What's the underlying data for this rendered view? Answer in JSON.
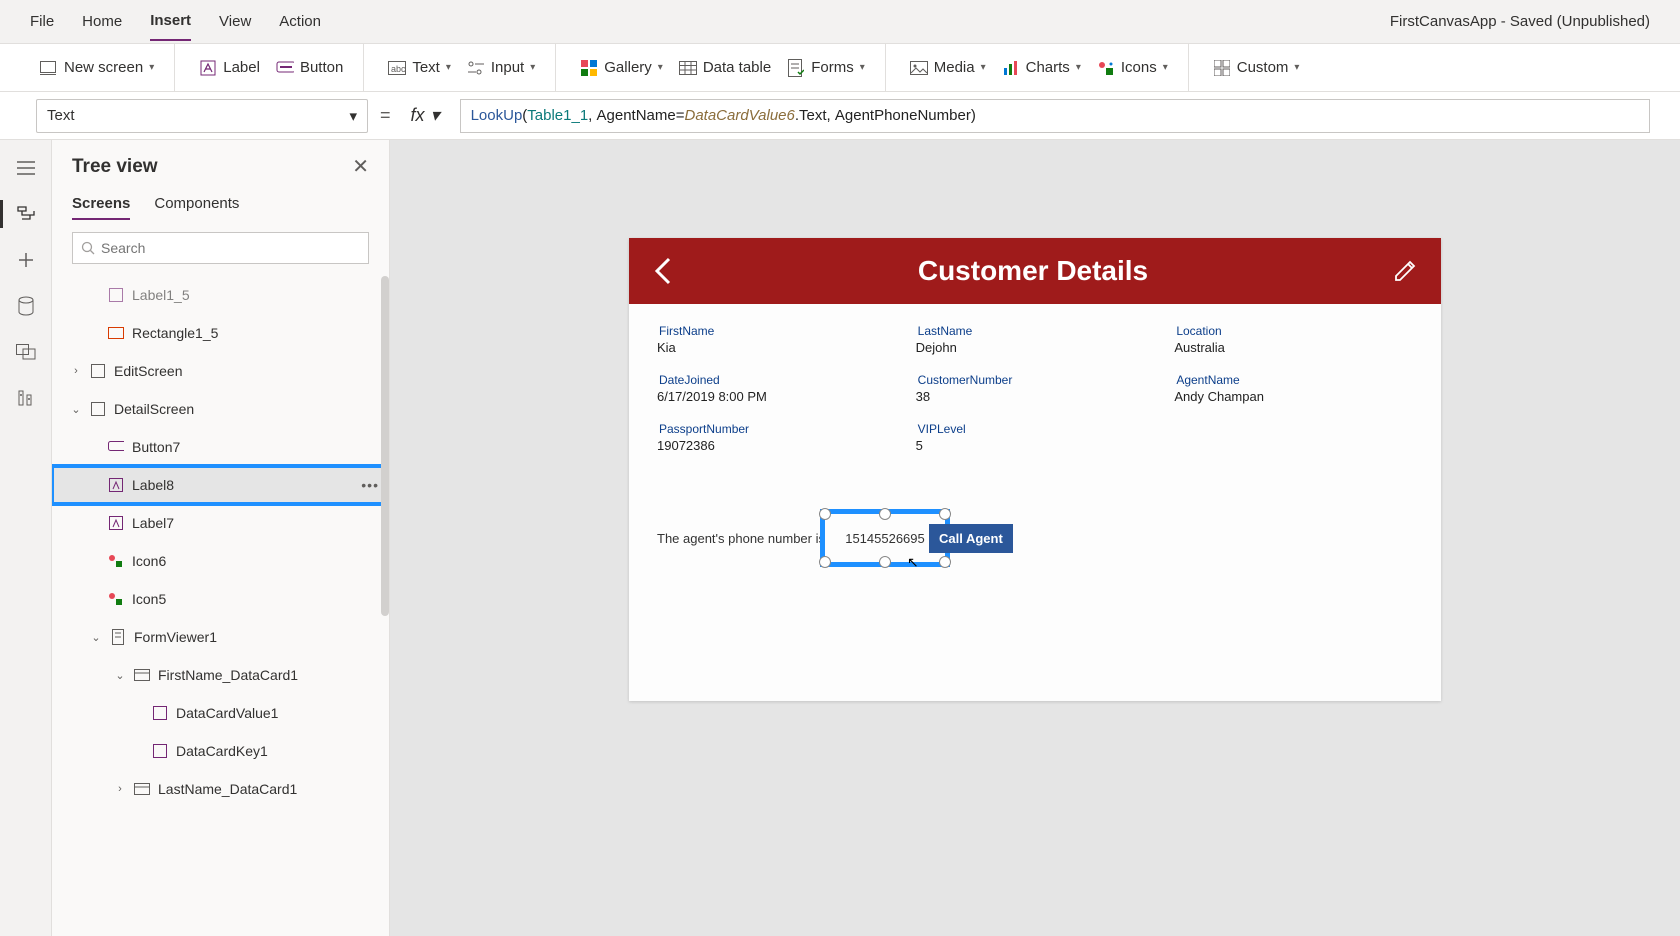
{
  "app_title": "FirstCanvasApp - Saved (Unpublished)",
  "menubar": {
    "file": "File",
    "home": "Home",
    "insert": "Insert",
    "view": "View",
    "action": "Action"
  },
  "ribbon": {
    "new_screen": "New screen",
    "label": "Label",
    "button": "Button",
    "text": "Text",
    "input": "Input",
    "gallery": "Gallery",
    "data_table": "Data table",
    "forms": "Forms",
    "media": "Media",
    "charts": "Charts",
    "icons": "Icons",
    "custom": "Custom"
  },
  "formula": {
    "property": "Text",
    "fx_label": "fx",
    "fn": "LookUp",
    "table": "Table1_1",
    "cond_left": "AgentName",
    "cond_eq": " = ",
    "cond_right": "DataCardValue6",
    "cond_suffix": ".Text",
    "result": "AgentPhoneNumber"
  },
  "tree": {
    "title": "Tree view",
    "tab_screens": "Screens",
    "tab_components": "Components",
    "search_placeholder": "Search",
    "nodes": {
      "label1_5": "Label1_5",
      "rectangle1_5": "Rectangle1_5",
      "edit_screen": "EditScreen",
      "detail_screen": "DetailScreen",
      "button7": "Button7",
      "label8": "Label8",
      "label7": "Label7",
      "icon6": "Icon6",
      "icon5": "Icon5",
      "formviewer1": "FormViewer1",
      "firstname_dc": "FirstName_DataCard1",
      "datacardvalue1": "DataCardValue1",
      "datacardkey1": "DataCardKey1",
      "lastname_dc": "LastName_DataCard1"
    }
  },
  "canvas": {
    "header_title": "Customer Details",
    "fields": {
      "firstname_l": "FirstName",
      "firstname_v": "Kia",
      "lastname_l": "LastName",
      "lastname_v": "Dejohn",
      "location_l": "Location",
      "location_v": "Australia",
      "datejoined_l": "DateJoined",
      "datejoined_v": "6/17/2019 8:00 PM",
      "customernumber_l": "CustomerNumber",
      "customernumber_v": "38",
      "agentname_l": "AgentName",
      "agentname_v": "Andy Champan",
      "passport_l": "PassportNumber",
      "passport_v": "19072386",
      "vip_l": "VIPLevel",
      "vip_v": "5"
    },
    "agent_prefix": "The agent's phone number is ",
    "agent_phone": "15145526695",
    "call_label": "Call Agent"
  }
}
